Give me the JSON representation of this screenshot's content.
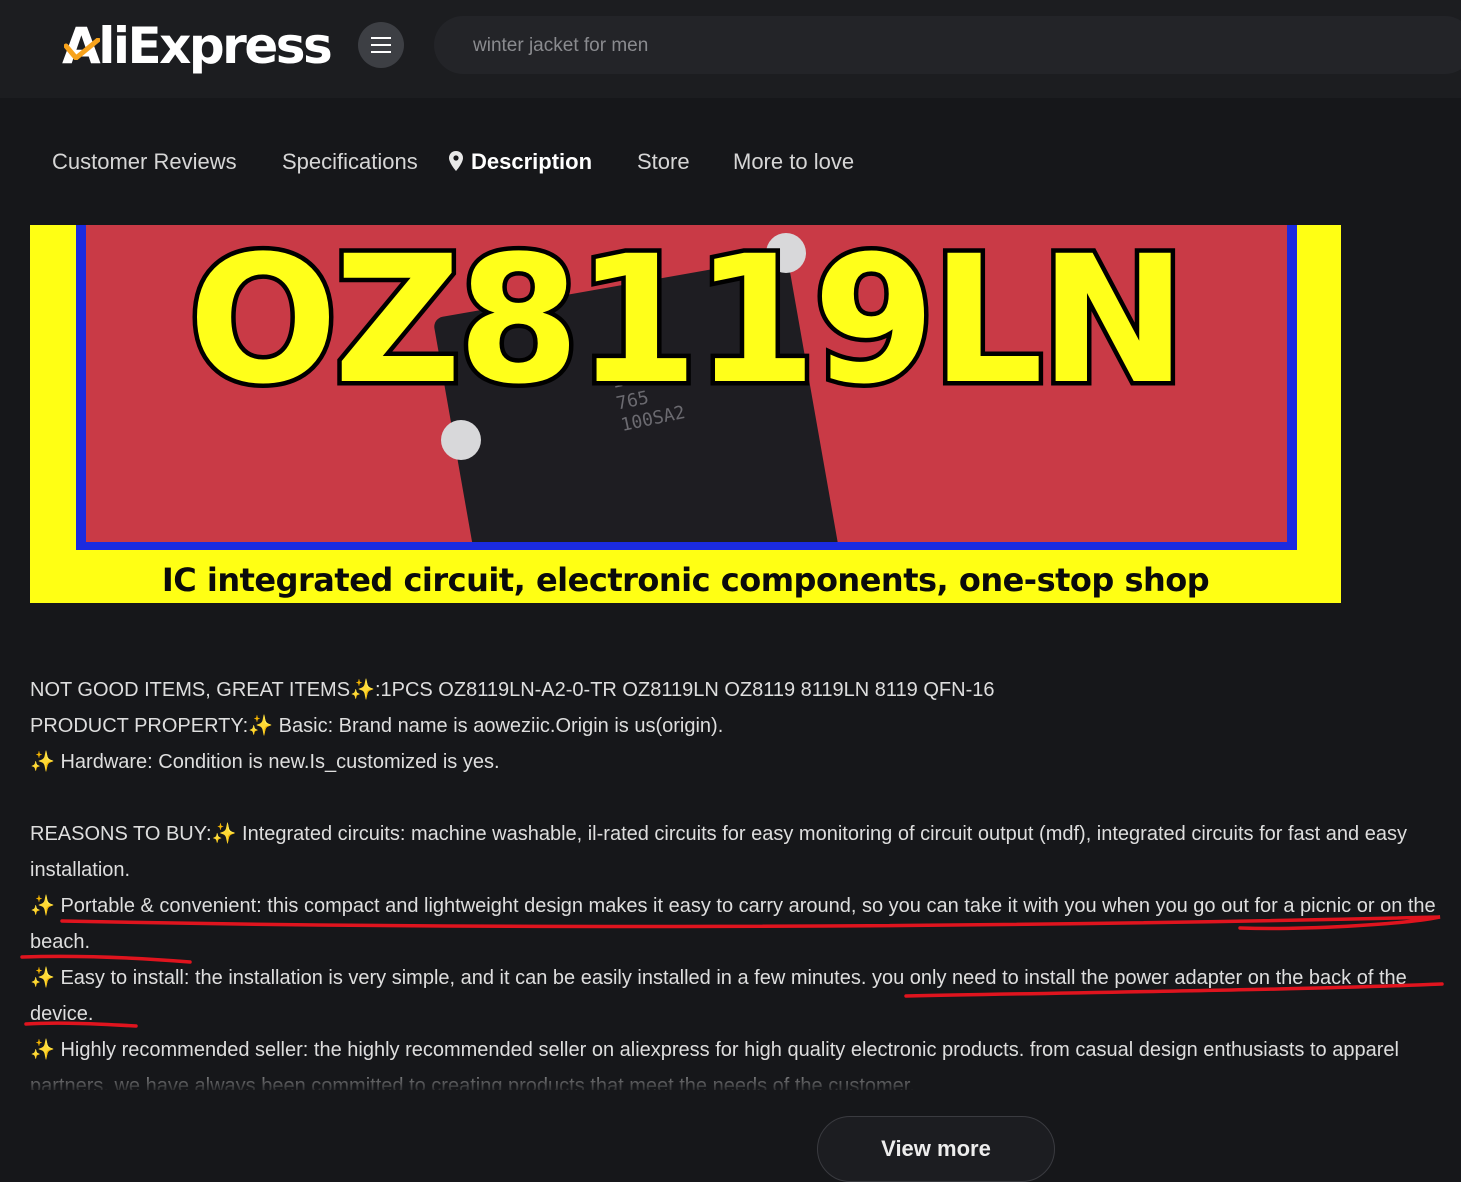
{
  "header": {
    "logo_text": "AliExpress",
    "menu_icon": "hamburger-menu-icon",
    "search": {
      "placeholder": "winter jacket for men",
      "value": ""
    }
  },
  "tabs": [
    {
      "label": "Customer Reviews",
      "active": false
    },
    {
      "label": "Specifications",
      "active": false
    },
    {
      "label": "Description",
      "active": true,
      "icon": "location-pin-icon"
    },
    {
      "label": "Store",
      "active": false
    },
    {
      "label": "More to love",
      "active": false
    }
  ],
  "banner": {
    "model": "OZ8119LN",
    "tagline": "IC integrated circuit, electronic components, one-stop shop",
    "chip_marking": [
      "119",
      "765",
      "100SA2"
    ]
  },
  "description": {
    "sparkle": "✨",
    "line1_a": "NOT GOOD ITEMS, GREAT ITEMS",
    "line1_b": ":1PCS OZ8119LN-A2-0-TR OZ8119LN OZ8119 8119LN 8119 QFN-16",
    "line2_a": "PRODUCT PROPERTY:",
    "line2_b": " Basic: Brand name is aoweziic.Origin is us(origin).",
    "line3": " Hardware: Condition is new.Is_customized is yes.",
    "line4_a": "REASONS TO BUY:",
    "line4_b": " Integrated circuits: machine washable, il-rated circuits for easy monitoring of circuit output (mdf), integrated circuits for fast and easy installation.",
    "line5": " Portable & convenient: this compact and lightweight design makes it easy to carry around, so you can take it with you when you go out for a picnic or on the beach.",
    "line6": " Easy to install: the installation is very simple, and it can be easily installed in a few minutes. you only need to install the power adapter on the back of the device.",
    "line7": " Highly recommended seller: the highly recommended seller on aliexpress for high quality electronic products. from casual design enthusiasts to apparel partners. we have always been committed to creating products that meet the needs of the customer."
  },
  "view_more_label": "View more",
  "colors": {
    "background": "#16171a",
    "banner_yellow": "#ffff14",
    "banner_red": "#c93a46",
    "banner_border": "#1b2be0",
    "annotation_red": "#e0141e"
  }
}
